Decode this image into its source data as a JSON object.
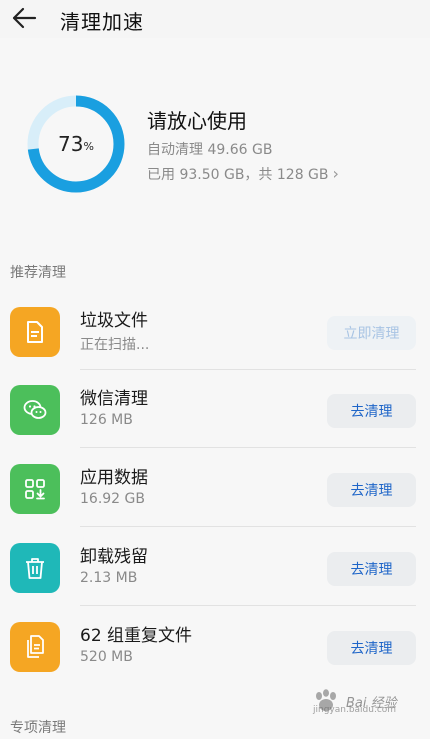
{
  "header": {
    "title": "清理加速"
  },
  "summary": {
    "percent": "73",
    "percent_sign": "%",
    "usage_fraction": 0.73,
    "status": "请放心使用",
    "auto_clean": "自动清理 49.66 GB",
    "used_text": "已用 93.50 GB，共 128 GB",
    "ring_color": "#1a9fe0",
    "ring_track_color": "#d8eef9"
  },
  "sections": {
    "recommended": "推荐清理",
    "special": "专项清理"
  },
  "items": [
    {
      "name": "垃圾文件",
      "size": "正在扫描...",
      "button": "立即清理",
      "color": "#f5a623",
      "icon": "document-icon"
    },
    {
      "name": "微信清理",
      "size": "126 MB",
      "button": "去清理",
      "color": "#4cbf5b",
      "icon": "wechat-icon"
    },
    {
      "name": "应用数据",
      "size": "16.92 GB",
      "button": "去清理",
      "color": "#4cbf5b",
      "icon": "app-data-icon"
    },
    {
      "name": "卸载残留",
      "size": "2.13 MB",
      "button": "去清理",
      "color": "#1fb8b8",
      "icon": "trash-icon"
    },
    {
      "name": "62 组重复文件",
      "size": "520 MB",
      "button": "去清理",
      "color": "#f5a623",
      "icon": "duplicate-file-icon"
    }
  ],
  "watermark": {
    "text": "Bai 经验",
    "sub": "jingyan.baidu.com"
  }
}
